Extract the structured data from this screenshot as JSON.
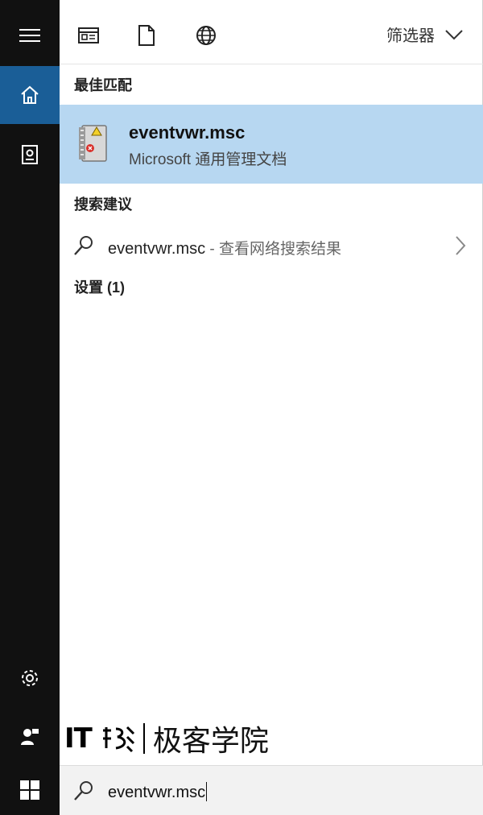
{
  "rail": {
    "items": [
      {
        "name": "hamburger-menu-icon"
      },
      {
        "name": "home-icon",
        "active": true
      },
      {
        "name": "notebook-icon"
      },
      {
        "name": "settings-icon"
      },
      {
        "name": "feedback-icon"
      },
      {
        "name": "windows-start-icon"
      }
    ]
  },
  "toolbar": {
    "icons": [
      "apps-filter-icon",
      "documents-filter-icon",
      "web-filter-icon"
    ],
    "filter_label": "筛选器"
  },
  "best_match": {
    "section_label": "最佳匹配",
    "title": "eventvwr.msc",
    "subtitle": "Microsoft 通用管理文档",
    "icon": "event-viewer-icon"
  },
  "suggestions": {
    "section_label": "搜索建议",
    "items": [
      {
        "text": "eventvwr.msc",
        "desc": " - 查看网络搜索结果"
      }
    ]
  },
  "settings": {
    "section_label": "设置 (1)"
  },
  "watermark": {
    "brand_it": "IT",
    "brand_cn": "极客学院"
  },
  "search": {
    "value": "eventvwr.msc"
  },
  "colors": {
    "rail_bg": "#111111",
    "active_bg": "#1a5e97",
    "highlight_bg": "#b7d7f1",
    "searchbox_bg": "#f2f2f2"
  }
}
